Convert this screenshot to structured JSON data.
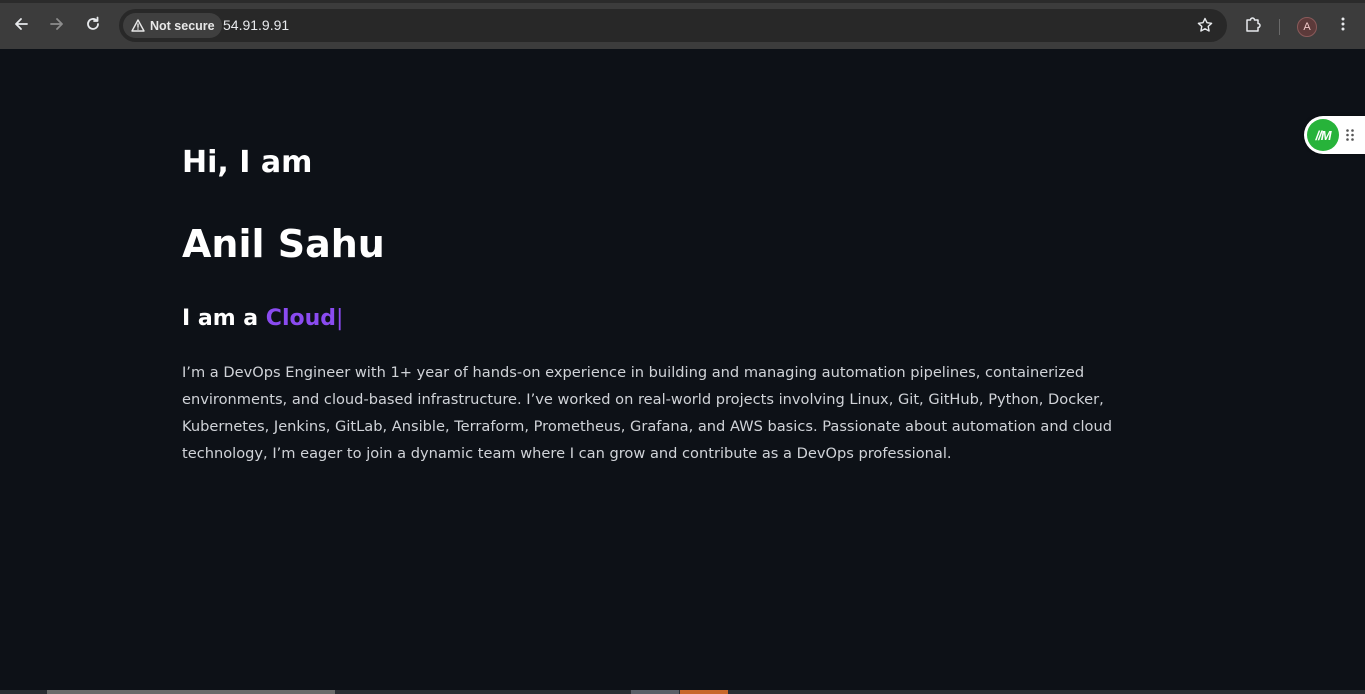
{
  "browser": {
    "security_label": "Not secure",
    "url": "54.91.9.91",
    "profile_initial": "A"
  },
  "hero": {
    "greeting": "Hi, I am",
    "name": "Anil Sahu",
    "role_prefix": "I am a",
    "role_word": "Cloud",
    "cursor": "|",
    "bio": "I’m a DevOps Engineer with 1+ year of hands-on experience in building and managing automation pipelines, containerized environments, and cloud-based infrastructure. I’ve worked on real-world projects involving Linux, Git, GitHub, Python, Docker, Kubernetes, Jenkins, GitLab, Ansible, Terraform, Prometheus, Grafana, and AWS basics. Passionate about automation and cloud technology, I’m eager to join a dynamic team where I can grow and contribute as a DevOps professional."
  },
  "extension_widget": {
    "logo_text": "//M"
  },
  "colors": {
    "page_background": "#0d1117",
    "accent": "#8a4bf0",
    "text": "#ffffff",
    "body_text": "#d0d3d8",
    "chrome_background": "#3c3c3c"
  }
}
